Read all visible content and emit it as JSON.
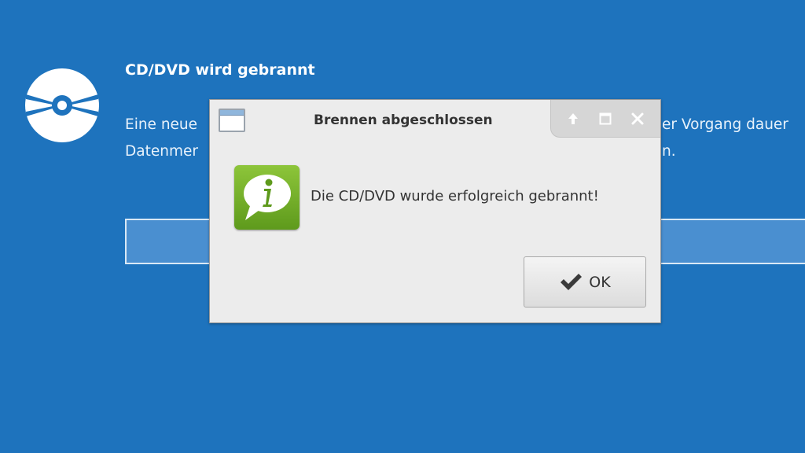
{
  "background_window": {
    "title": "CD/DVD wird gebrannt",
    "line1_left": "Eine neue",
    "line1_right": "er Vorgang dauer",
    "line2_left": "Datenmer",
    "line2_right": "n.",
    "disc_icon": "disc-burn-icon"
  },
  "dialog": {
    "title": "Brennen abgeschlossen",
    "window_icon": "window-icon",
    "controls": [
      "shade-up-icon",
      "maximize-icon",
      "close-icon"
    ],
    "info_icon": "info-speech-bubble-icon",
    "message": "Die CD/DVD wurde erfolgreich gebrannt!",
    "ok_label": "OK",
    "ok_icon": "checkmark-icon"
  },
  "colors": {
    "desktop_bg": "#1e73bd",
    "dialog_bg": "#ececec",
    "info_green": "#6fae25"
  }
}
